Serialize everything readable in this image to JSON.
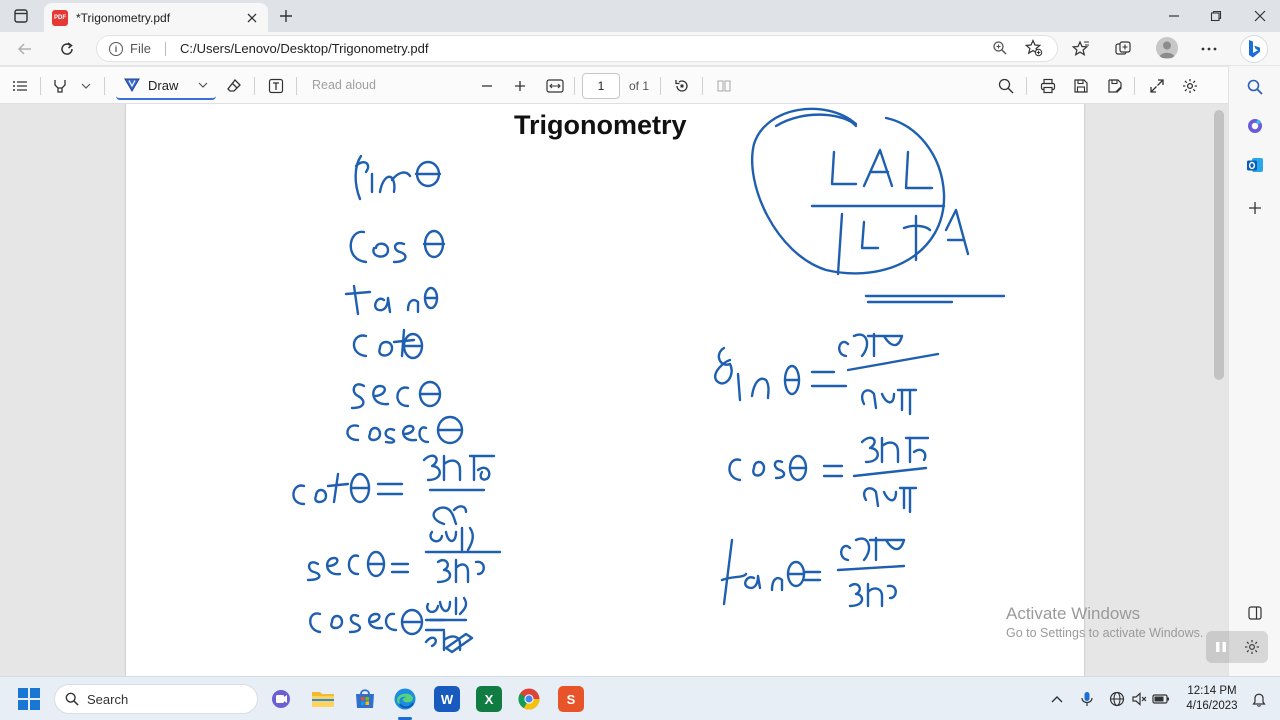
{
  "browser": {
    "tab_title": "*Trigonometry.pdf",
    "tab_icon": "PDF",
    "address_scheme": "File",
    "address_url": "C:/Users/Lenovo/Desktop/Trigonometry.pdf"
  },
  "pdf_toolbar": {
    "draw_label": "Draw",
    "read_aloud_label": "Read aloud",
    "page_number": "1",
    "page_count_label": "of 1"
  },
  "document": {
    "title": "Trigonometry",
    "ink_color": "#1f5fb0"
  },
  "watermark": {
    "line1": "Activate Windows",
    "line2": "Go to Settings to activate Windows."
  },
  "taskbar": {
    "search_label": "Search",
    "time": "12:14 PM",
    "date": "4/16/2023",
    "word_label": "W",
    "excel_label": "X",
    "app_s_label": "S"
  },
  "colors": {
    "accent": "#3b6fd1",
    "pdf_badge": "#e53935"
  }
}
